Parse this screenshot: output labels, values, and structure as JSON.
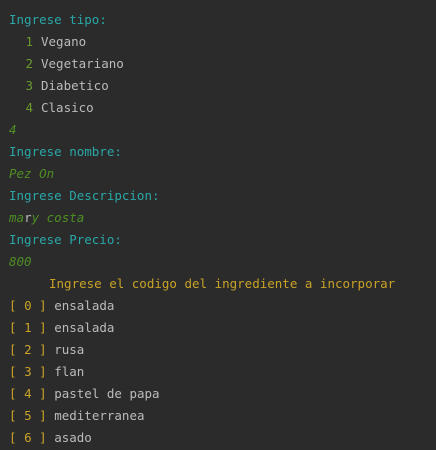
{
  "console": {
    "prompt_tipo": "Ingrese tipo:",
    "tipo_options": [
      {
        "num": "1",
        "label": "Vegano"
      },
      {
        "num": "2",
        "label": "Vegetariano"
      },
      {
        "num": "3",
        "label": "Diabetico"
      },
      {
        "num": "4",
        "label": "Clasico"
      }
    ],
    "tipo_input": "4",
    "prompt_nombre": "Ingrese nombre:",
    "nombre_input": "Pez On",
    "prompt_descripcion": "Ingrese Descripcion:",
    "descripcion_input_before": "ma",
    "descripcion_input_caret": "r",
    "descripcion_input_after": "y costa",
    "prompt_precio": "Ingrese Precio:",
    "precio_input": "800",
    "ingredientes_header": "Ingrese el codigo del ingrediente a incorporar",
    "ingredientes": [
      {
        "bracket_open": "[",
        "index": "0",
        "bracket_close": "]",
        "name": "ensalada"
      },
      {
        "bracket_open": "[",
        "index": "1",
        "bracket_close": "]",
        "name": "ensalada"
      },
      {
        "bracket_open": "[",
        "index": "2",
        "bracket_close": "]",
        "name": "rusa"
      },
      {
        "bracket_open": "[",
        "index": "3",
        "bracket_close": "]",
        "name": "flan"
      },
      {
        "bracket_open": "[",
        "index": "4",
        "bracket_close": "]",
        "name": "pastel de papa"
      },
      {
        "bracket_open": "[",
        "index": "5",
        "bracket_close": "]",
        "name": "mediterranea"
      },
      {
        "bracket_open": "[",
        "index": "6",
        "bracket_close": "]",
        "name": "asado"
      }
    ]
  },
  "colors": {
    "background": "#2b2b2b",
    "prompt": "#2aa7a7",
    "user_input": "#4e8f24",
    "menu_number": "#6a9a2b",
    "ingredient_accent": "#c9a227",
    "text": "#bbbbbb"
  }
}
